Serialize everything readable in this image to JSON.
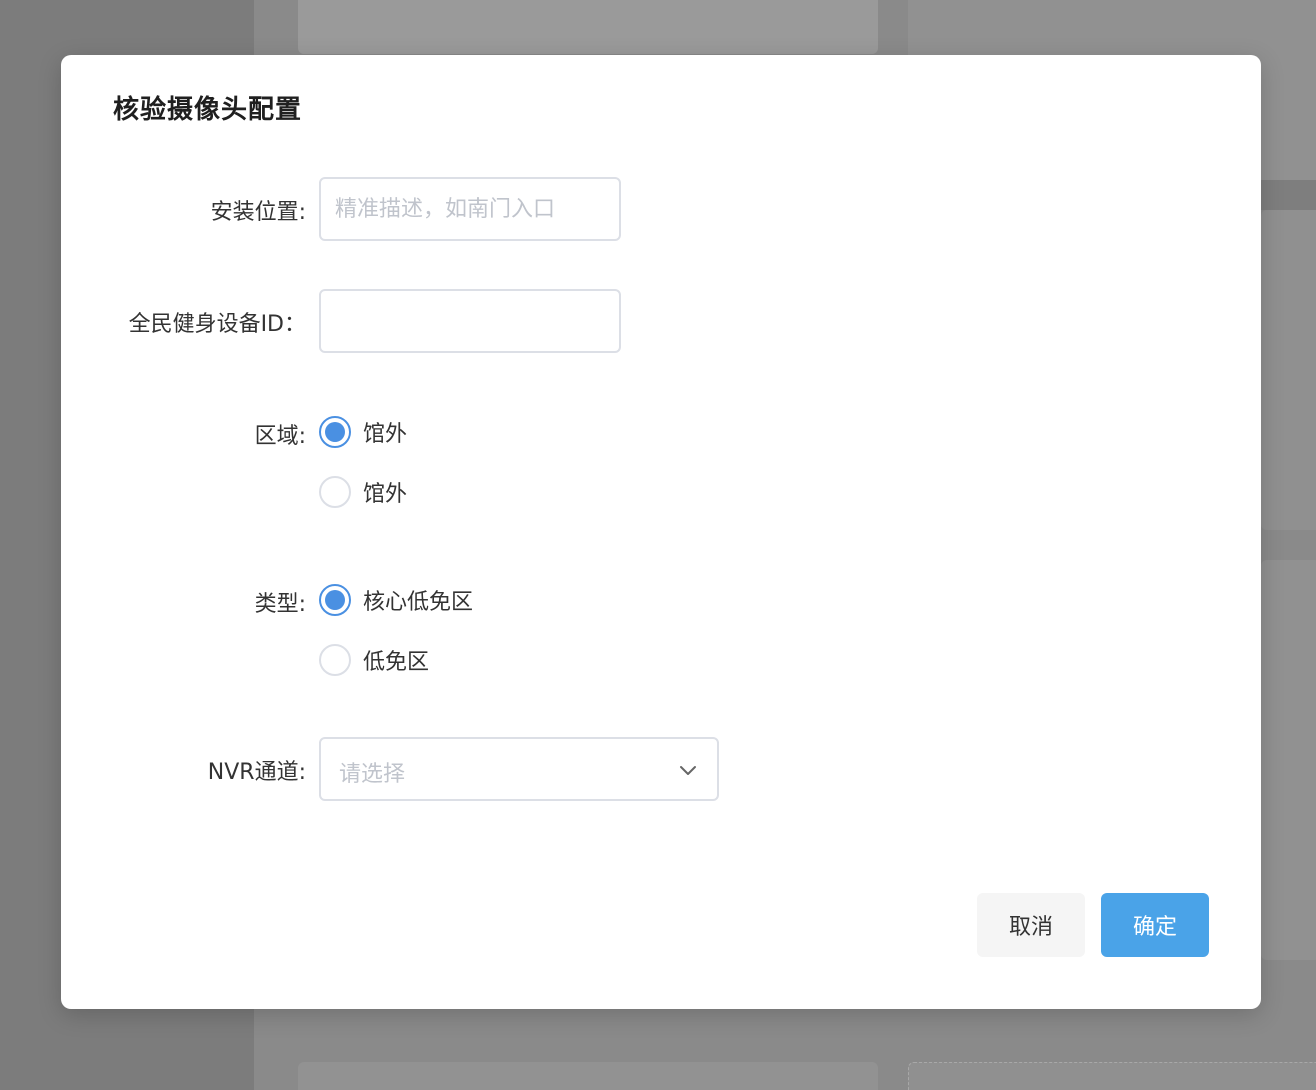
{
  "dialog": {
    "title": "核验摄像头配置"
  },
  "form": {
    "location": {
      "label": "安装位置:",
      "value": "",
      "placeholder": "精准描述，如南门入口"
    },
    "device_id": {
      "label": "全民健身设备ID：",
      "value": "",
      "placeholder": ""
    },
    "area": {
      "label": "区域:",
      "options": [
        {
          "label": "馆外",
          "checked": true
        },
        {
          "label": "馆外",
          "checked": false
        }
      ]
    },
    "type": {
      "label": "类型:",
      "options": [
        {
          "label": "核心低免区",
          "checked": true
        },
        {
          "label": "低免区",
          "checked": false
        }
      ]
    },
    "nvr_channel": {
      "label": "NVR通道:",
      "placeholder": "请选择",
      "icon": "chevron-down-icon"
    }
  },
  "footer": {
    "cancel_label": "取消",
    "confirm_label": "确定"
  },
  "colors": {
    "accent": "#4a90e2",
    "confirm_button": "#4aa3e8",
    "overlay": "#8a8a8a"
  }
}
